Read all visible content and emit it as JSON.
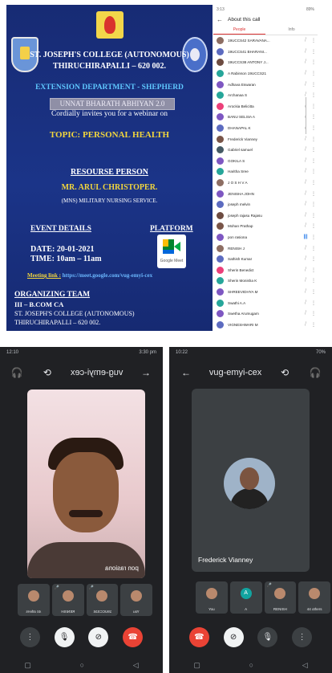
{
  "poster": {
    "college": "ST. JOSEPH'S COLLEGE (AUTONOMOUS)",
    "city": "THIRUCHIRAPALLI – 620 002.",
    "department": "EXTENSION DEPARTMENT - SHEPHERD",
    "banner": "UNNAT BHARATH ABHIYAN 2.0",
    "invite": "Cordially invites you for a webinar on",
    "topic": "TOPIC: PERSONAL HEALTH",
    "resource_heading": "RESOURSE PERSON",
    "speaker": "MR. ARUL CHRISTOPER.",
    "service": "(MNS) MILITARY NURSING SERVICE.",
    "event_heading": "EVENT DETAILS",
    "date": "DATE: 20-01-2021",
    "time": "TIME: 10am – 11am",
    "platform_heading": "PLATFORM",
    "platform_logo_label": "Google Meet",
    "meeting_label": "Meeting link :",
    "meeting_url": "https://meet.google.com/vug-emyi-cex",
    "organizing_heading": "ORGANIZING TEAM",
    "org_team": "III – B.COM CA",
    "org_college": "ST. JOSEPH'S COLLEGE (AUTONOMOUS)",
    "org_city": "THIRUCHIRAPALLI – 620 002."
  },
  "participants": {
    "status_time": "3:13",
    "status_right": "89%",
    "header": "About this call",
    "tab_people": "People",
    "tab_info": "Info",
    "list": [
      {
        "name": "19UCCS42 SARAVANA...",
        "color": "#8d6e63"
      },
      {
        "name": "19UCCS41 BHARANI...",
        "color": "#5c6bc0"
      },
      {
        "name": "19UCCS38 ANTONY J...",
        "color": "#6d4c41"
      },
      {
        "name": "A Rabinson 19UCCS21",
        "color": "#26a69a"
      },
      {
        "name": "Adhava Eswaran",
        "color": "#7e57c2"
      },
      {
        "name": "Archanaa S",
        "color": "#26a69a"
      },
      {
        "name": "Arockia Belicitta",
        "color": "#ec407a"
      },
      {
        "name": "BANU SELSIA A",
        "color": "#7e57c2"
      },
      {
        "name": "DHANAPAL K",
        "color": "#5c6bc0"
      },
      {
        "name": "Frederick Vianney",
        "color": "#795548"
      },
      {
        "name": "Gabriel samuel",
        "color": "#455a64"
      },
      {
        "name": "GOKILA S",
        "color": "#7e57c2"
      },
      {
        "name": "Haritha Sree",
        "color": "#26a69a"
      },
      {
        "name": "J O S H V A",
        "color": "#8d6e63"
      },
      {
        "name": "JENISHA JOHN",
        "color": "#7e57c2"
      },
      {
        "name": "joseph melvin",
        "color": "#5c6bc0"
      },
      {
        "name": "joseph rajasu Rajasu",
        "color": "#6d4c41"
      },
      {
        "name": "Mohan Prathap",
        "color": "#795548"
      },
      {
        "name": "pon rasiona",
        "color": "#7e57c2",
        "active": true
      },
      {
        "name": "RENISH J",
        "color": "#8d6e63"
      },
      {
        "name": "Sathish Kumar",
        "color": "#5c6bc0"
      },
      {
        "name": "Sherin Benedict",
        "color": "#ec407a"
      },
      {
        "name": "Sherin Monisha K",
        "color": "#26a69a"
      },
      {
        "name": "SHREEVIDHYA M",
        "color": "#7e57c2"
      },
      {
        "name": "Swathi A.A",
        "color": "#26a69a"
      },
      {
        "name": "Swetha Arumugam",
        "color": "#7e57c2"
      },
      {
        "name": "VIGNESHWARI M",
        "color": "#5c6bc0"
      }
    ]
  },
  "phone_left": {
    "status_left": "12:10",
    "status_right": "3:30 pm",
    "meeting_code": "vug-emyi-cex",
    "main_caption": "pon rasiona",
    "thumbs": [
      "44 others",
      "RENISH",
      "19UCCS34",
      "You"
    ]
  },
  "phone_right": {
    "status_left": "10:22",
    "status_right": "70%",
    "meeting_code": "vug-emyi-cex",
    "main_caption": "Frederick Vianney",
    "thumbs": [
      "You",
      "A",
      "RENISH",
      "44 others"
    ],
    "thumb_letter": "A"
  },
  "icons": {
    "headphones": "🎧",
    "switch_camera": "⟲",
    "arrow": "→",
    "more": "⋮",
    "mic_off": "🎙",
    "video_off": "⊘",
    "end_call": "☎",
    "mic": "🎙",
    "nav_back": "◁",
    "nav_home": "○",
    "nav_recent": "▢",
    "mic_small": "🎤"
  }
}
